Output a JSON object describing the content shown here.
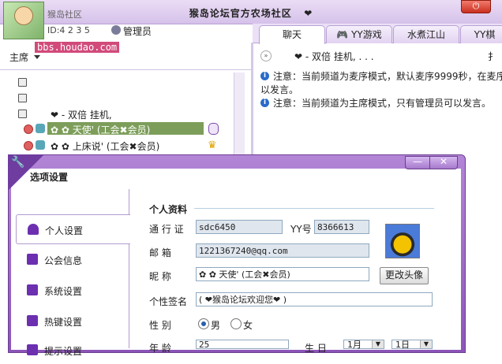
{
  "window": {
    "title": "猴岛论坛官方农场社区",
    "title_suffix": "❤",
    "channel_name": "猴岛社区",
    "channel_id": "ID:4 2 3 5",
    "role": "管理员",
    "watermark": "bbs.houdao.com",
    "power_icon": "power-icon"
  },
  "tabs": [
    "聊天",
    "YY游戏",
    "水煮江山",
    "YY棋"
  ],
  "sidebar": {
    "host_mode": "主席",
    "tree": [
      {
        "text": "❤  -     双倍 挂机,"
      },
      {
        "text": "✿   ✿      天使'    (工会✖会员)",
        "selected": true
      },
      {
        "text": "✿   ✿    上床说'    (工会✖会员)"
      }
    ]
  },
  "chat": {
    "header": "❤  -      双倍 挂机, . . .",
    "messages": [
      "注意：当前频道为麦序模式，默认麦序9999秒，在麦序",
      "以发言。",
      "注意：当前频道为主席模式，只有管理员可以发言。"
    ]
  },
  "dialog": {
    "title": "选项设置",
    "min_label": "—",
    "close_label": "✕",
    "nav": [
      {
        "label": "个人设置",
        "icon": "person-icon",
        "active": true
      },
      {
        "label": "公会信息",
        "icon": "flag-icon"
      },
      {
        "label": "系统设置",
        "icon": "settings-icon"
      },
      {
        "label": "热键设置",
        "icon": "key-icon"
      },
      {
        "label": "提示设置",
        "icon": "bell-icon"
      }
    ],
    "profile": {
      "section_title": "个人资料",
      "passport_label": "通 行 证",
      "passport_value": "sdc6450",
      "yy_label": "YY号",
      "yy_value": "8366613",
      "email_label": "邮    箱",
      "email_value": "1221367240@qq.com",
      "nickname_label": "昵    称",
      "nickname_value": "✿   ✿      天使'    (工会✖会员)",
      "change_avatar": "更改头像",
      "signature_label": "个性签名",
      "signature_value": "(  ❤猴岛论坛欢迎您❤  )",
      "gender_label": "性    别",
      "gender_male": "男",
      "gender_female": "女",
      "gender_selected": "male",
      "age_label": "年    龄",
      "age_value": "25",
      "birthday_label": "生    日",
      "birth_month": "1月",
      "birth_day": "1日"
    }
  }
}
